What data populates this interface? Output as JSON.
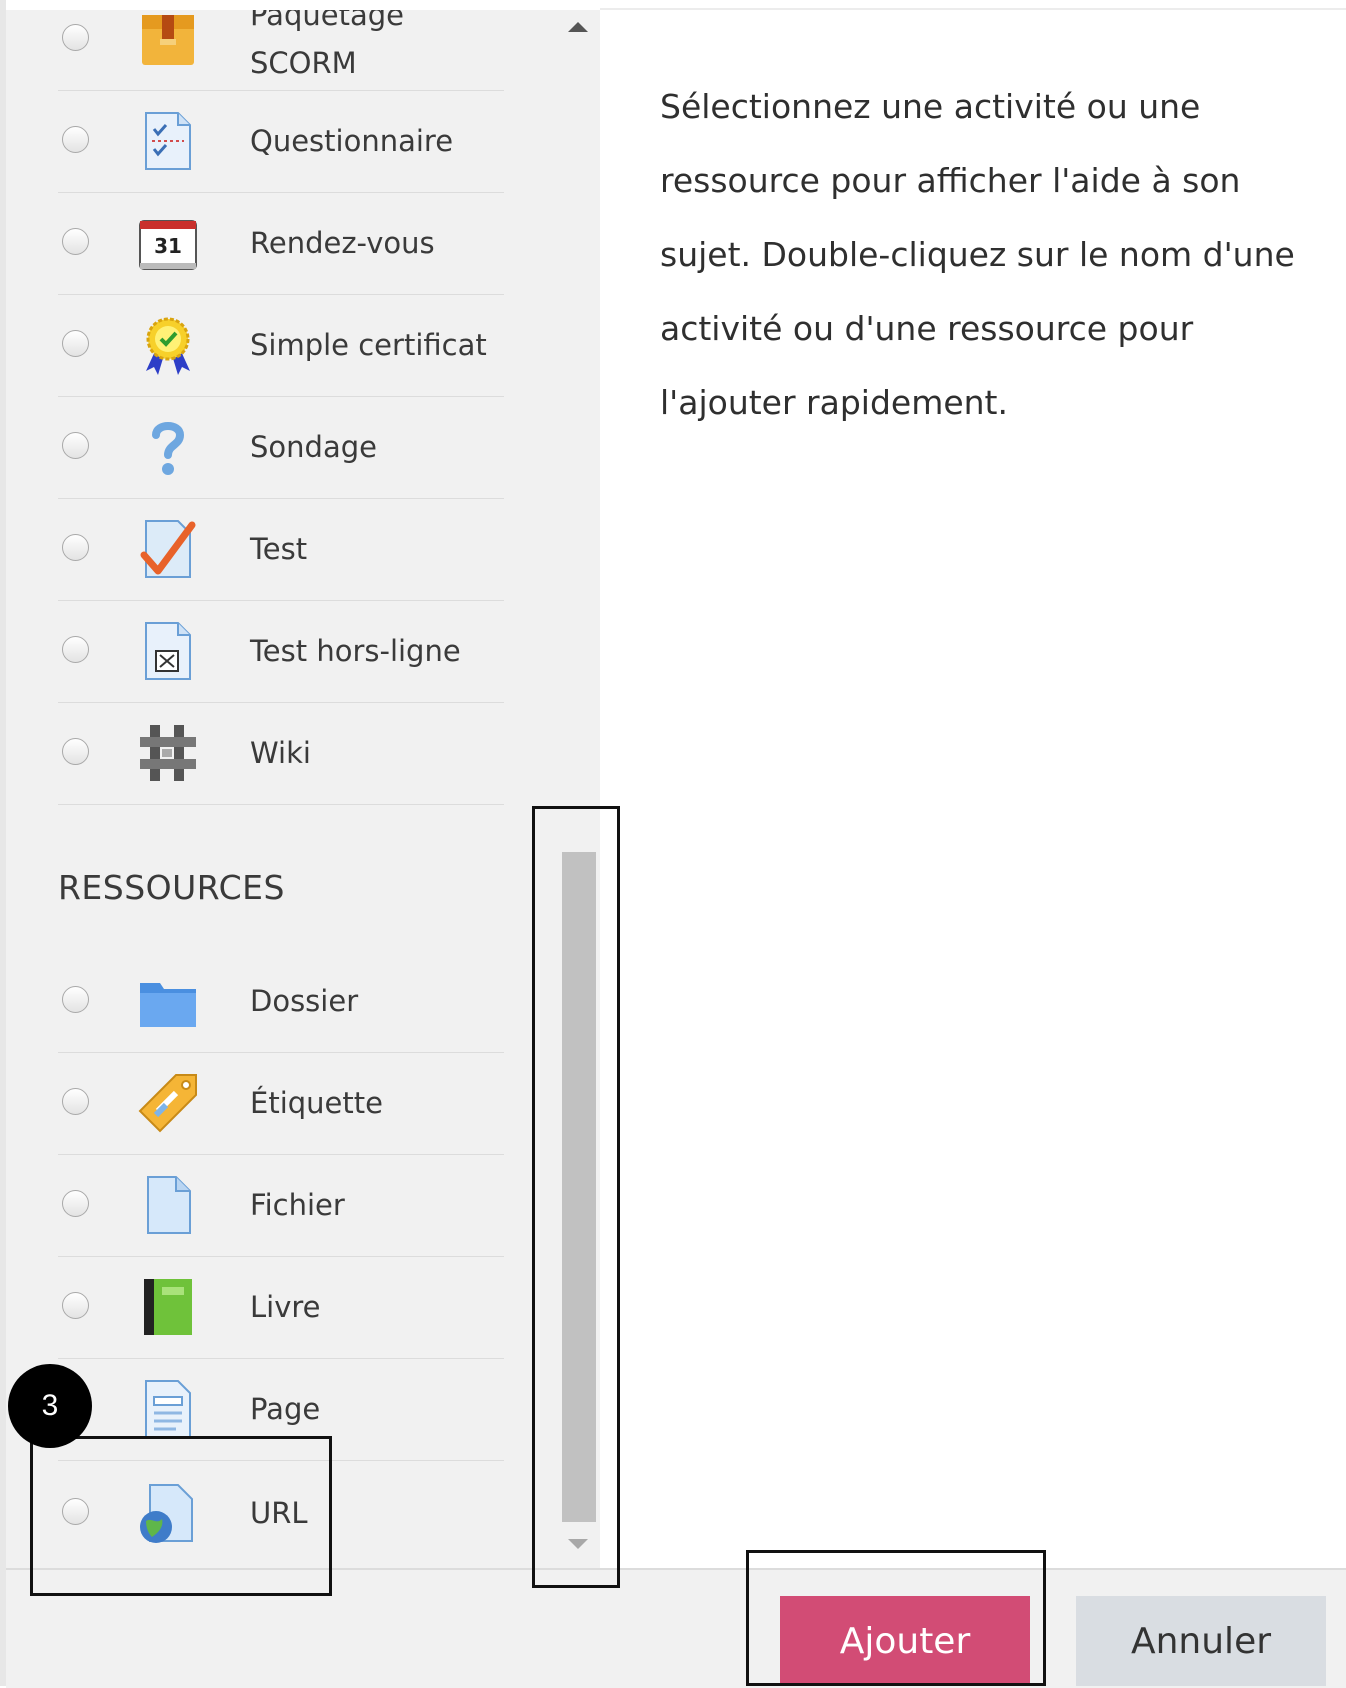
{
  "activities": [
    {
      "label": "Paquetage\nSCORM",
      "icon": "scorm-package-icon"
    },
    {
      "label": "Questionnaire",
      "icon": "questionnaire-icon"
    },
    {
      "label": "Rendez-vous",
      "icon": "calendar-icon"
    },
    {
      "label": "Simple certificat",
      "icon": "certificate-icon"
    },
    {
      "label": "Sondage",
      "icon": "question-mark-icon"
    },
    {
      "label": "Test",
      "icon": "quiz-checkmark-icon"
    },
    {
      "label": "Test hors-ligne",
      "icon": "offline-quiz-icon"
    },
    {
      "label": "Wiki",
      "icon": "wiki-icon"
    }
  ],
  "resources_heading": "RESSOURCES",
  "resources": [
    {
      "label": "Dossier",
      "icon": "folder-icon"
    },
    {
      "label": "Étiquette",
      "icon": "label-tag-icon"
    },
    {
      "label": "Fichier",
      "icon": "file-icon"
    },
    {
      "label": "Livre",
      "icon": "book-icon"
    },
    {
      "label": "Page",
      "icon": "page-icon"
    },
    {
      "label": "URL",
      "icon": "url-globe-icon"
    }
  ],
  "help_text": "Sélectionnez une activité ou une ressource pour afficher l'aide à son sujet. Double-cliquez sur le nom d'une activité ou d'une ressource pour l'ajouter rapidement.",
  "buttons": {
    "add": "Ajouter",
    "cancel": "Annuler"
  },
  "step_badge": "3",
  "colors": {
    "primary": "#d24c75",
    "secondary": "#d9dde2"
  }
}
